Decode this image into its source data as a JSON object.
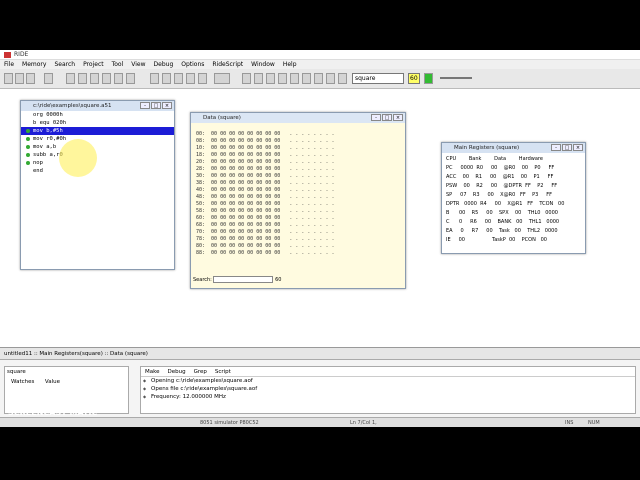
{
  "app": {
    "title": "RIDE",
    "menu": [
      "File",
      "Memory",
      "Search",
      "Project",
      "Tool",
      "View",
      "Debug",
      "Options",
      "RideScript",
      "Window",
      "Help"
    ]
  },
  "toolbar": {
    "combo_value": "square",
    "speed_value": "60"
  },
  "editor": {
    "title": "c:\\ride\\examples\\square.a51",
    "lines": [
      "org 0000h",
      "b equ 020h",
      "mov b,#5h",
      "mov r0,#0h",
      "mov a,b",
      "subb a,r0",
      "nop",
      "end"
    ]
  },
  "data_window": {
    "title": "Data (square)",
    "search_label": "Search:",
    "search_count": "60",
    "rows": [
      "00:",
      "08:",
      "10:",
      "18:",
      "20:",
      "28:",
      "30:",
      "38:",
      "40:",
      "48:",
      "50:",
      "58:",
      "60:",
      "68:",
      "70:",
      "78:",
      "80:",
      "88:"
    ]
  },
  "registers": {
    "title": "Main Registers (square)",
    "headers": [
      "CPU",
      "Bank",
      "Data",
      "Hardware"
    ],
    "rows": [
      [
        "PC",
        "0000",
        "R0",
        "00",
        "@R0",
        "00",
        "P0",
        "FF"
      ],
      [
        "ACC",
        "00",
        "R1",
        "00",
        "@R1",
        "00",
        "P1",
        "FF"
      ],
      [
        "PSW",
        "00",
        "R2",
        "00",
        "@DPTR",
        "FF",
        "P2",
        "FF"
      ],
      [
        "SP",
        "07",
        "R3",
        "00",
        "X@R0",
        "FF",
        "P3",
        "FF"
      ],
      [
        "DPTR",
        "0000",
        "R4",
        "00",
        "X@R1",
        "FF",
        "TCON",
        "00"
      ],
      [
        "B",
        "00",
        "R5",
        "00",
        "SPX",
        "00",
        "THL0",
        "0000"
      ],
      [
        "C",
        "0",
        "R6",
        "00",
        "BANK",
        "00",
        "THL1",
        "0000"
      ],
      [
        "EA",
        "0",
        "R7",
        "00",
        "Task",
        "00",
        "THL2",
        "0000"
      ],
      [
        "IE",
        "00",
        "",
        "",
        "TaskP",
        "00",
        "PCON",
        "00"
      ]
    ]
  },
  "tabs": "untitled11 :: Main Registers(square) :: Data (square)",
  "watch": {
    "title": "square",
    "col1": "Watches",
    "col2": "Value"
  },
  "output": {
    "tabs": [
      "Make",
      "Debug",
      "Grep",
      "Script"
    ],
    "lines": [
      "Opening c:\\ride\\examples\\square.aof",
      "Opens file c:\\ride\\examples\\square.aof",
      "Frequency: 12.000000 MHz"
    ]
  },
  "watermark": {
    "line1": "RECORDED WITH",
    "line2": "SCREENCAST MATIC"
  },
  "status": {
    "sim": "8051 simulator P80C52",
    "pos": "Ln 7/Col 1,",
    "ins": "INS",
    "num": "NUM"
  }
}
